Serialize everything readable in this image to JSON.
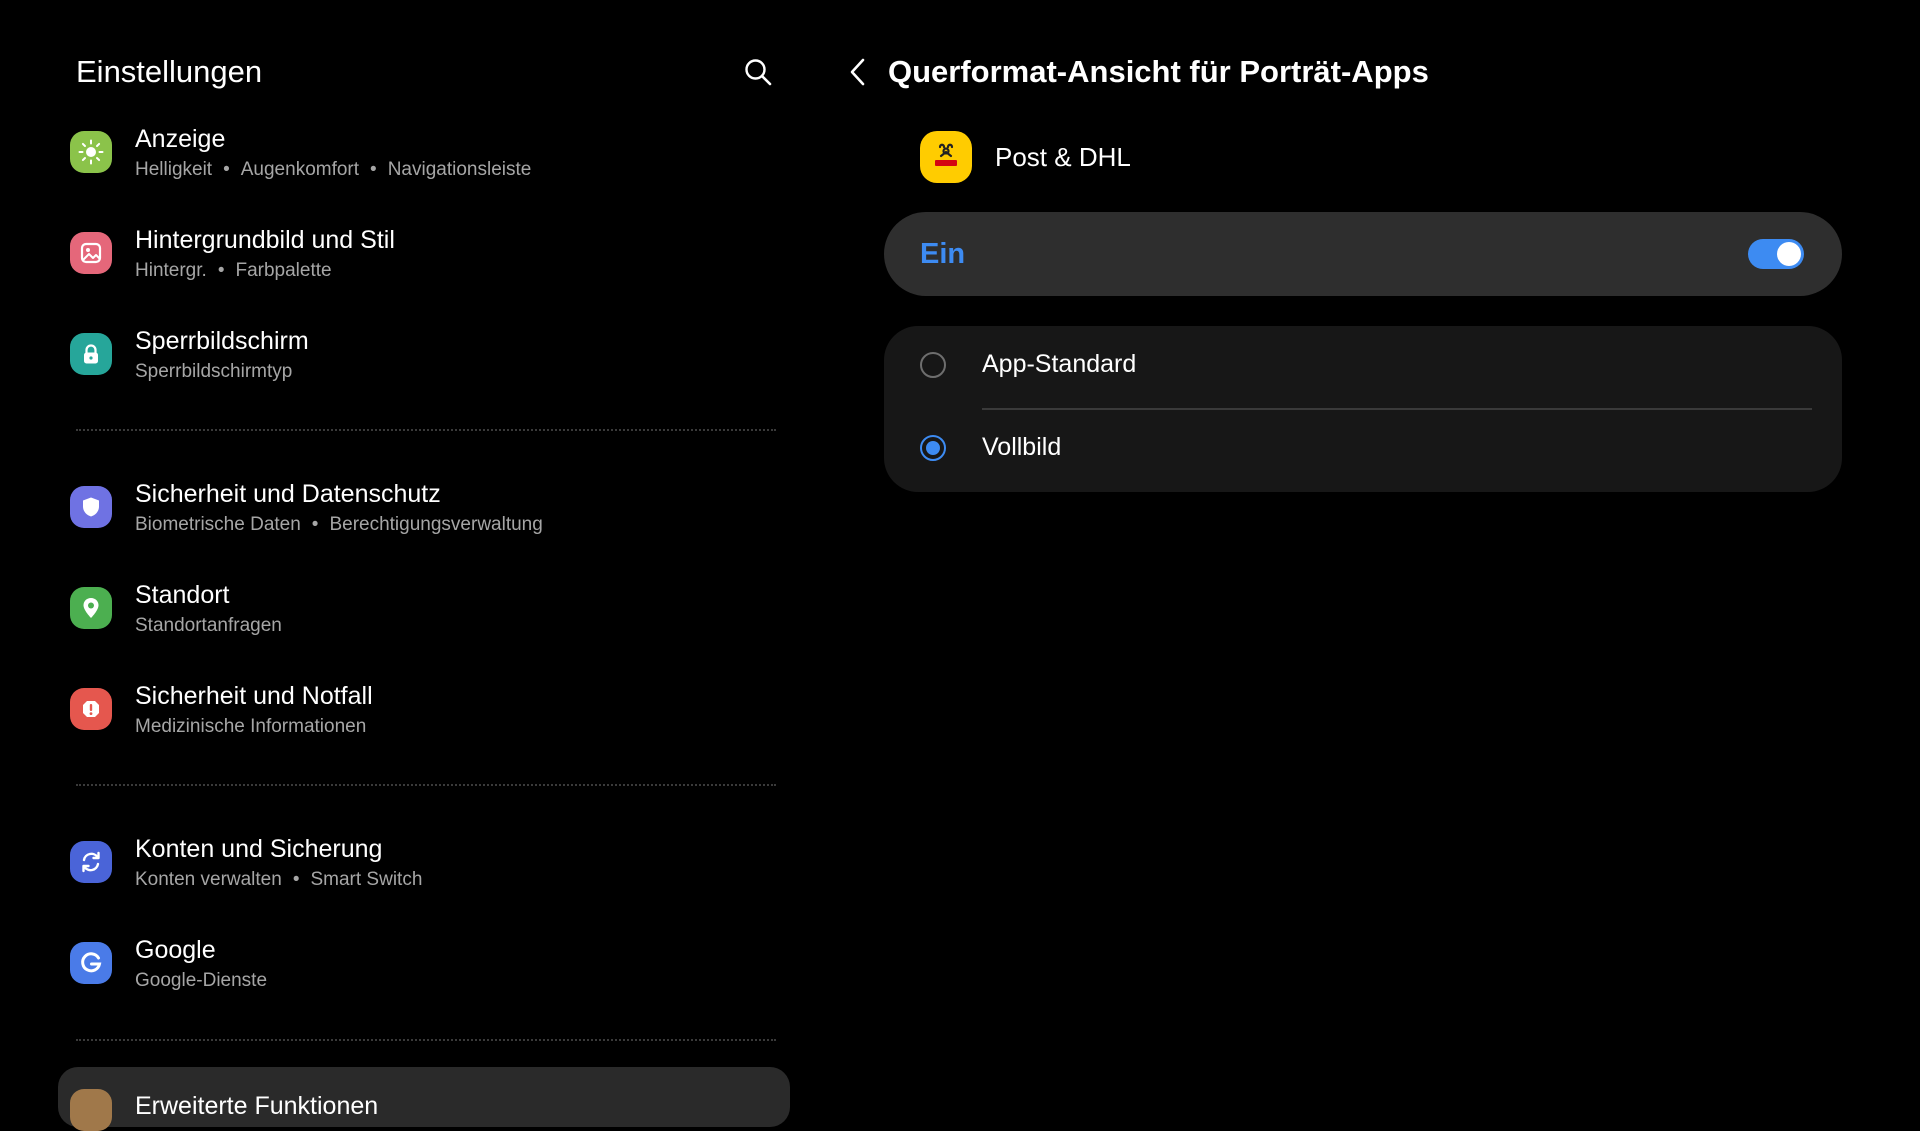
{
  "left": {
    "title": "Einstellungen",
    "items": [
      {
        "id": "anzeige",
        "title": "Anzeige",
        "subs": [
          "Helligkeit",
          "Augenkomfort",
          "Navigationsleiste"
        ],
        "icon": "sun-icon",
        "color": "#8bc34a"
      },
      {
        "id": "hintergrund",
        "title": "Hintergrundbild und Stil",
        "subs": [
          "Hintergr.",
          "Farbpalette"
        ],
        "icon": "image-icon",
        "color": "#e5677a"
      },
      {
        "id": "sperrbild",
        "title": "Sperrbildschirm",
        "subs": [
          "Sperrbildschirmtyp"
        ],
        "icon": "lock-icon",
        "color": "#26a69a"
      },
      {
        "id": "sicherheit",
        "title": "Sicherheit und Datenschutz",
        "subs": [
          "Biometrische Daten",
          "Berechtigungsverwaltung"
        ],
        "icon": "shield-icon",
        "color": "#6f72e3"
      },
      {
        "id": "standort",
        "title": "Standort",
        "subs": [
          "Standortanfragen"
        ],
        "icon": "location-pin-icon",
        "color": "#4caf50"
      },
      {
        "id": "notfall",
        "title": "Sicherheit und Notfall",
        "subs": [
          "Medizinische Informationen"
        ],
        "icon": "alert-icon",
        "color": "#e5574e"
      },
      {
        "id": "konten",
        "title": "Konten und Sicherung",
        "subs": [
          "Konten verwalten",
          "Smart Switch"
        ],
        "icon": "sync-icon",
        "color": "#4a64d8"
      },
      {
        "id": "google",
        "title": "Google",
        "subs": [
          "Google-Dienste"
        ],
        "icon": "google-icon",
        "color": "#4a7be8"
      }
    ],
    "peek_item_title": "Erweiterte Funktionen"
  },
  "right": {
    "title": "Querformat-Ansicht für Porträt-Apps",
    "app_name": "Post & DHL",
    "app_icon": "dhl-app-icon",
    "app_icon_color": "#ffcc00",
    "toggle_label": "Ein",
    "toggle_on": true,
    "accent_color": "#3d8bf2",
    "options": [
      {
        "label": "App-Standard",
        "selected": false
      },
      {
        "label": "Vollbild",
        "selected": true
      }
    ]
  }
}
